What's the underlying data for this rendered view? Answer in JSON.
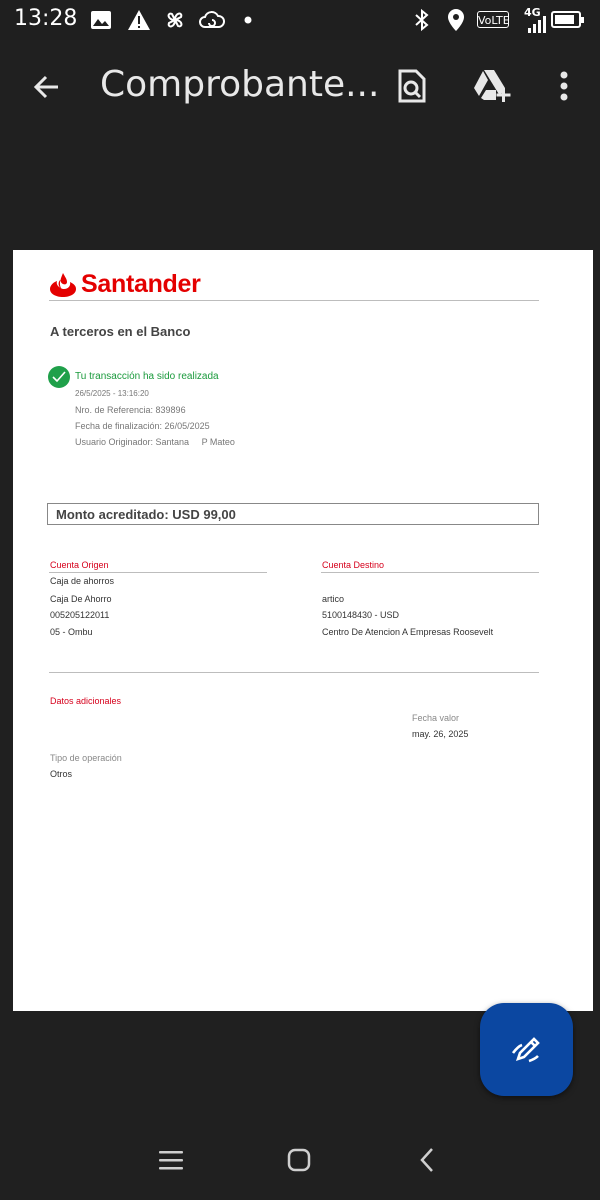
{
  "status_bar": {
    "time": "13:28",
    "icons": [
      "image-icon",
      "alert-icon",
      "pinwheel-icon",
      "cloud-sync-icon",
      "dot-icon",
      "bluetooth-icon",
      "location-icon",
      "volte-icon",
      "signal-icon",
      "battery-icon"
    ],
    "volte": "VoLTE",
    "network": "4G",
    "battery_level": 0.85
  },
  "app_bar": {
    "title": "Comprobante...",
    "actions": [
      "back-arrow-icon",
      "find-in-doc-icon",
      "add-to-drive-icon",
      "more-vert-icon"
    ]
  },
  "document": {
    "brand": "Santander",
    "brand_color": "#e40000",
    "subtitle": "A terceros en el Banco",
    "success_message": "Tu transacción ha sido realizada",
    "datetime": "26/5/2025 - 13:16:20",
    "reference": "Nro. de Referencia: 839896",
    "end_date": "Fecha de finalización: 26/05/2025",
    "user": "Usuario Originador: Santana     P Mateo",
    "amount": "Monto acreditado: USD 99,00",
    "origin": {
      "label": "Cuenta Origen",
      "type": "Caja de ahorros",
      "account_name": "Caja De Ahorro",
      "account_number": "005205122011",
      "branch": "05 - Ombu"
    },
    "destination": {
      "label": "Cuenta Destino",
      "name": "artico",
      "account": "5100148430 - USD",
      "branch": "Centro De Atencion A Empresas Roosevelt"
    },
    "additional": {
      "label": "Datos adicionales",
      "value_date_label": "Fecha valor",
      "value_date": "may. 26, 2025",
      "operation_label": "Tipo de operación",
      "operation": "Otros"
    }
  },
  "fab": {
    "icon": "edit-pen-icon",
    "color": "#0b47a1"
  },
  "nav_bar": {
    "buttons": [
      "recents-icon",
      "home-icon",
      "back-icon"
    ]
  }
}
